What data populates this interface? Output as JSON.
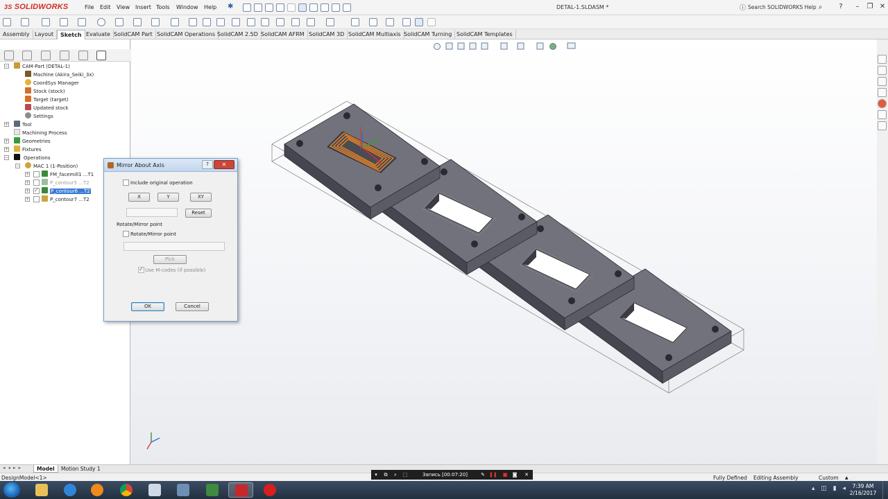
{
  "app": {
    "logo": "SOLIDWORKS",
    "logo_prefix": "3S",
    "document": "DETAL-1.SLDASM *"
  },
  "menu": [
    "File",
    "Edit",
    "View",
    "Insert",
    "Tools",
    "Window",
    "Help"
  ],
  "help_search": {
    "placeholder": "Search SOLIDWORKS Help"
  },
  "command_tabs": [
    "Assembly",
    "Layout",
    "Sketch",
    "Evaluate",
    "SolidCAM Part",
    "SolidCAM Operations",
    "SolidCAM 2.5D",
    "SolidCAM AFRM",
    "SolidCAM 3D",
    "SolidCAM Multiaxis",
    "SolidCAM Turning",
    "SolidCAM Templates"
  ],
  "active_tab": "Sketch",
  "tree": {
    "root": "CAM-Part (DETAL-1)",
    "machine": "Machine (Akira_Seiki_3x)",
    "coordsys": "CoordSys Manager",
    "stock": "Stock (stock)",
    "target": "Target (target)",
    "updated_stock": "Updated stock",
    "settings": "Settings",
    "tool": "Tool",
    "machining_process": "Machining Process",
    "geometries": "Geometries",
    "fixtures": "Fixtures",
    "operations": "Operations",
    "mac": "MAC 1 (1-Position)",
    "ops": [
      {
        "label": "FM_facemill1 ...T1",
        "dim": false,
        "selected": false
      },
      {
        "label": "P_contour5 ...T2",
        "dim": true,
        "selected": false
      },
      {
        "label": "P_contour6 ...T2",
        "dim": false,
        "selected": true
      },
      {
        "label": "P_contour7 ...T2",
        "dim": false,
        "selected": false
      }
    ]
  },
  "dialog": {
    "title": "Mirror About Axis",
    "include_original": "Include original operation",
    "axis_x": "X",
    "axis_y": "Y",
    "axis_xy": "XY",
    "reset": "Reset",
    "group_label": "Rotate/Mirror point",
    "rotate_checkbox": "Rotate/Mirror point",
    "pick": "Pick",
    "use_mcodes": "Use M-codes (if possible)",
    "ok": "OK",
    "cancel": "Cancel"
  },
  "bottom_tabs": [
    "Model",
    "Motion Study 1"
  ],
  "status": {
    "left": "DesignModel<1>",
    "fully_defined": "Fully Defined",
    "editing": "Editing Assembly",
    "units": "Custom"
  },
  "recording": {
    "label": "Запись [00:07:20]"
  },
  "clock": {
    "time": "7:39 AM",
    "date": "2/16/2017"
  },
  "colors": {
    "brand": "#d22c23",
    "part": "#6e6f78",
    "toolpath": "#ff8a1f",
    "selection": "#3a7bd5"
  }
}
